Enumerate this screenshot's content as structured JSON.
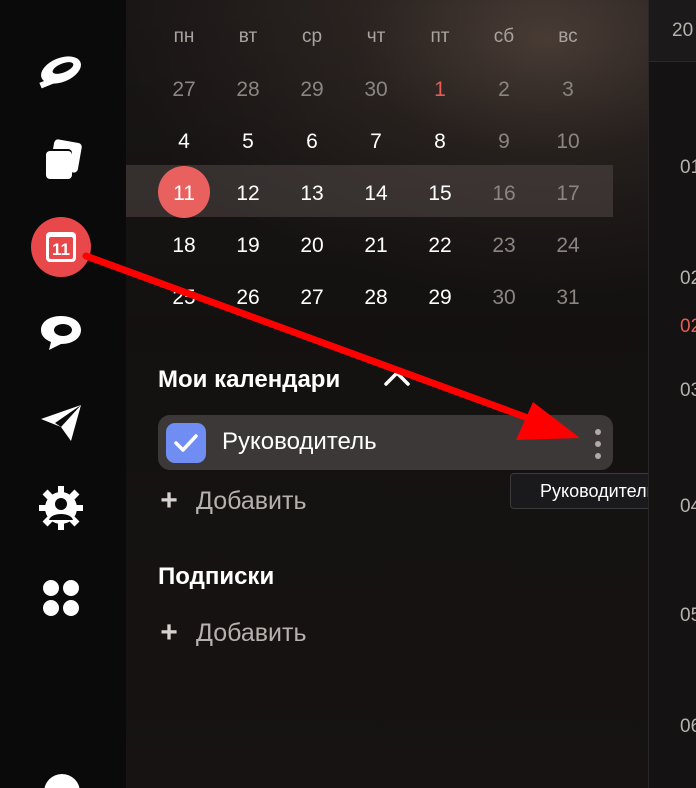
{
  "rail": {
    "items": [
      {
        "icon": "messenger-icon"
      },
      {
        "icon": "disk-icon"
      },
      {
        "icon": "calendar-icon",
        "badge": "11",
        "color": "#e8484a"
      },
      {
        "icon": "chat-icon"
      },
      {
        "icon": "telemost-icon"
      },
      {
        "icon": "settings-person-icon"
      },
      {
        "icon": "apps-grid-icon"
      }
    ]
  },
  "calendar": {
    "weekdays": [
      "пн",
      "вт",
      "ср",
      "чт",
      "пт",
      "сб",
      "вс"
    ],
    "weeks": [
      [
        "27",
        "28",
        "29",
        "30",
        "1",
        "2",
        "3"
      ],
      [
        "4",
        "5",
        "6",
        "7",
        "8",
        "9",
        "10"
      ],
      [
        "11",
        "12",
        "13",
        "14",
        "15",
        "16",
        "17"
      ],
      [
        "18",
        "19",
        "20",
        "21",
        "22",
        "23",
        "24"
      ],
      [
        "25",
        "26",
        "27",
        "28",
        "29",
        "30",
        "31"
      ]
    ],
    "today": "11"
  },
  "my_calendars": {
    "title": "Мои календари",
    "items": [
      {
        "label": "Руководитель",
        "checked": true
      }
    ],
    "add_label": "Добавить"
  },
  "subscriptions": {
    "title": "Подписки",
    "add_label": "Добавить"
  },
  "tooltip": {
    "text": "Руководитель"
  },
  "right_panel": {
    "header_fragment": "20",
    "times": [
      "01",
      "02",
      "02",
      "03",
      "04",
      "05",
      "06"
    ]
  },
  "colors": {
    "accent_red": "#e8615f",
    "checkbox_blue": "#6f8df2",
    "annotation_arrow": "#ff0000"
  }
}
